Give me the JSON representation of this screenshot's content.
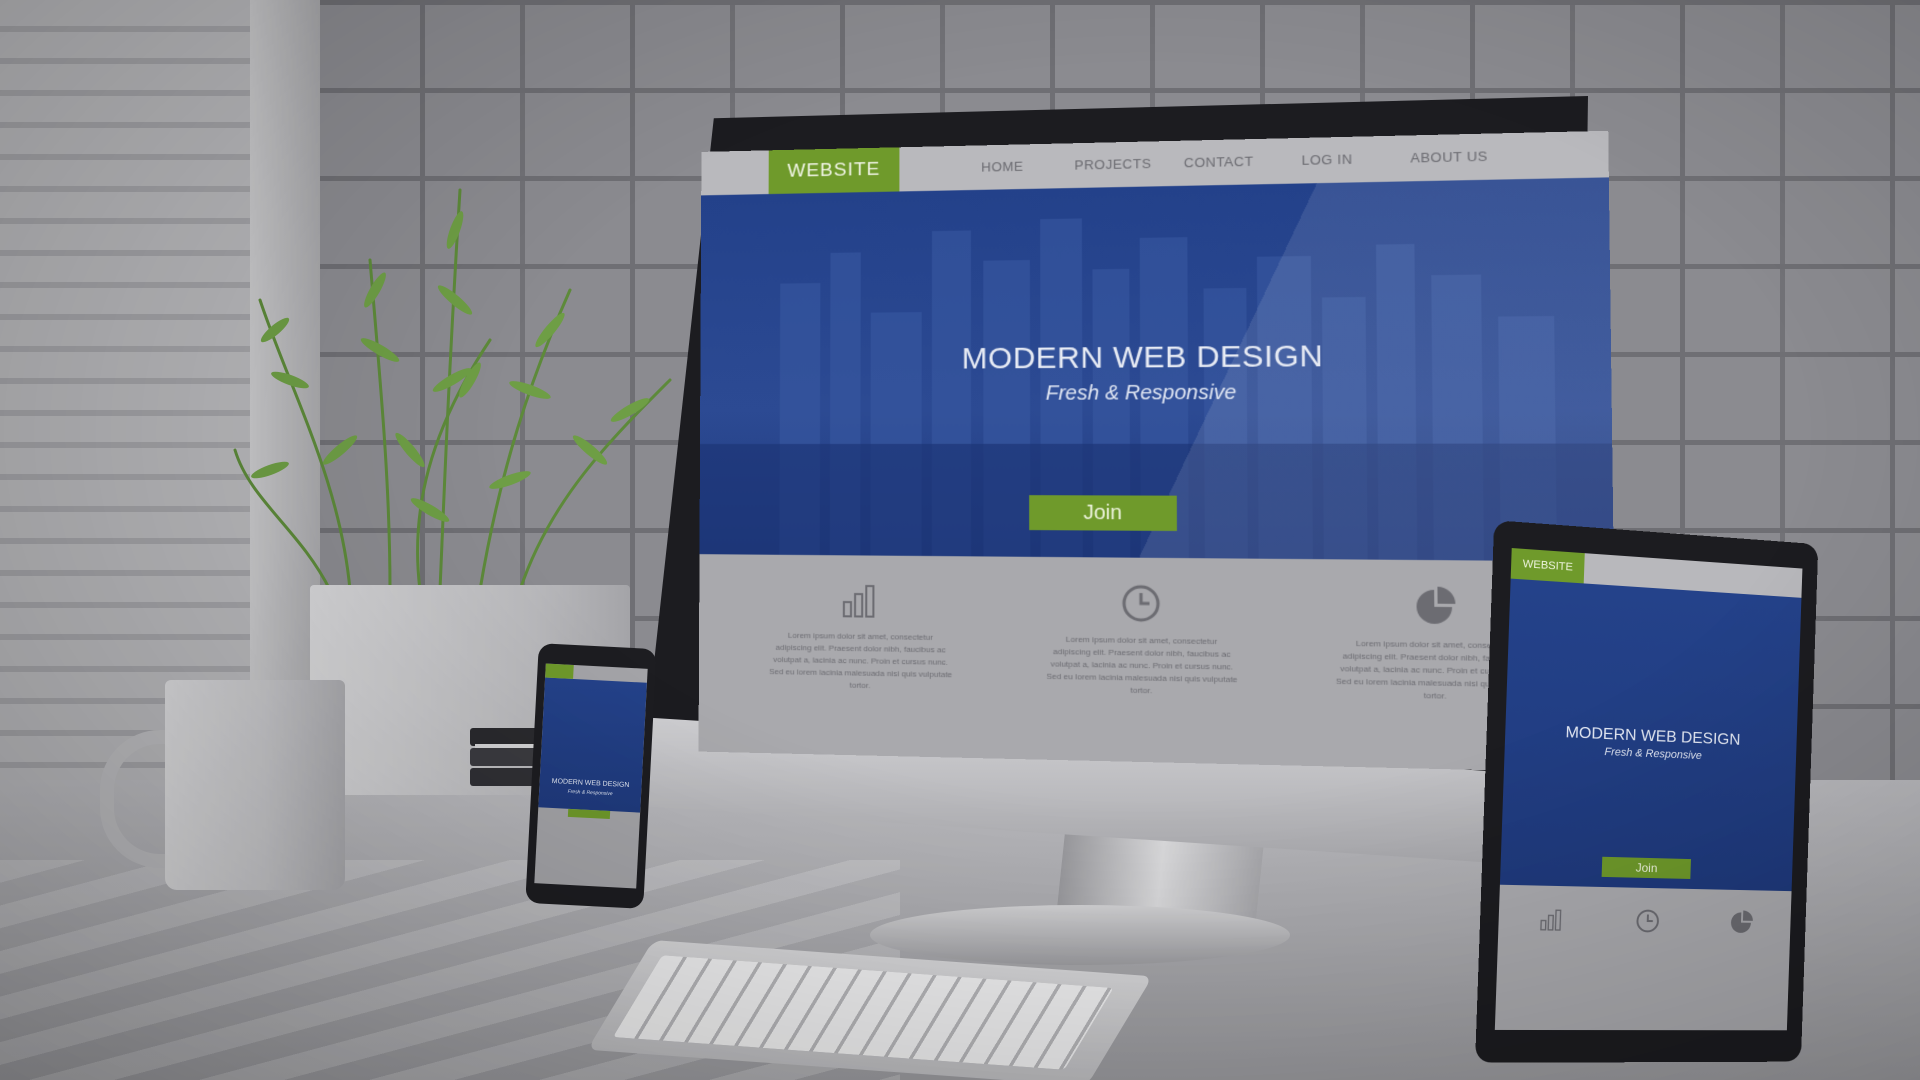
{
  "monitor": {
    "logo": "WEBSITE",
    "nav": [
      "HOME",
      "PROJECTS",
      "CONTACT",
      "LOG IN",
      "ABOUT US"
    ],
    "hero": {
      "title": "MODERN WEB DESIGN",
      "subtitle": "Fresh & Responsive",
      "cta": "Join"
    },
    "features": [
      {
        "icon": "bar-chart-icon",
        "text": "Lorem ipsum dolor sit amet, consectetur adipiscing elit. Praesent dolor nibh, faucibus ac volutpat a, lacinia ac nunc. Proin et cursus nunc. Sed eu lorem lacinia malesuada nisi quis vulputate tortor."
      },
      {
        "icon": "clock-icon",
        "text": "Lorem ipsum dolor sit amet, consectetur adipiscing elit. Praesent dolor nibh, faucibus ac volutpat a, lacinia ac nunc. Proin et cursus nunc. Sed eu lorem lacinia malesuada nisi quis vulputate tortor."
      },
      {
        "icon": "pie-chart-icon",
        "text": "Lorem ipsum dolor sit amet, consectetur adipiscing elit. Praesent dolor nibh, faucibus ac volutpat a, lacinia ac nunc. Proin et cursus nunc. Sed eu lorem lacinia malesuada nisi quis vulputate tortor."
      }
    ]
  },
  "tablet": {
    "logo": "WEBSITE",
    "hero": {
      "title": "MODERN WEB DESIGN",
      "subtitle": "Fresh & Responsive",
      "cta": "Join"
    }
  },
  "phone": {
    "hero": {
      "title": "MODERN WEB DESIGN",
      "subtitle": "Fresh & Responsive"
    }
  },
  "colors": {
    "accent_green": "#6f9a2b",
    "hero_blue": "#2c4a93",
    "nav_gray": "#b9b9bd"
  }
}
